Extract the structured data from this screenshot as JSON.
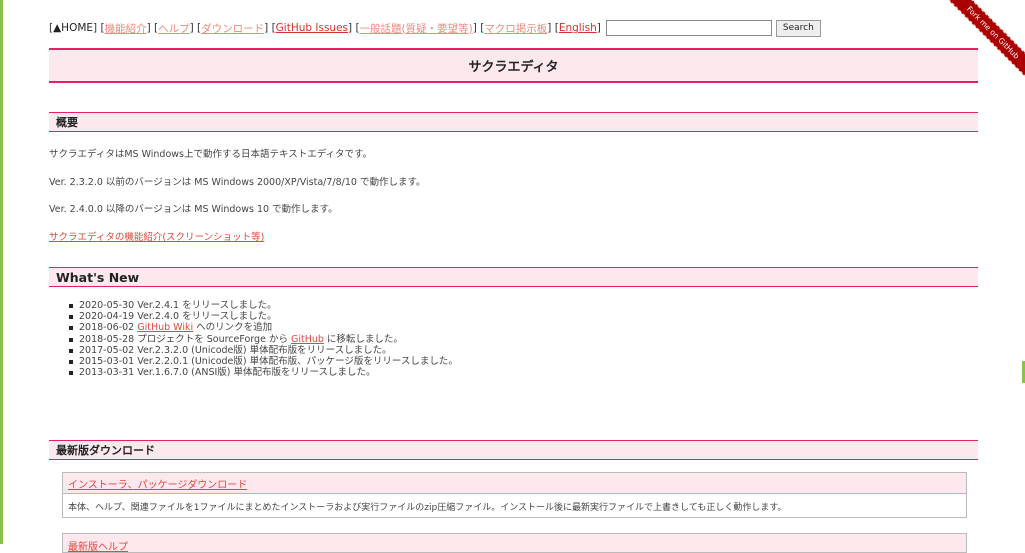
{
  "nav": {
    "home": "▲HOME",
    "features": "機能紹介",
    "help": "ヘルプ",
    "download": "ダウンロード",
    "issues": "GitHub Issues",
    "forum": "一般話題(質疑・要望等)",
    "macro": "マクロ掲示板",
    "english": "English",
    "search_value": "",
    "search_button": "Search"
  },
  "ribbon": "Fork me on GitHub",
  "page_title": "サクラエディタ",
  "overview": {
    "heading": "概要",
    "lines": [
      "サクラエディタはMS Windows上で動作する日本語テキストエディタです。",
      "Ver. 2.3.2.0 以前のバージョンは MS Windows 2000/XP/Vista/7/8/10 で動作します。",
      "Ver. 2.4.0.0 以降のバージョンは MS Windows 10 で動作します。"
    ],
    "link": "サクラエディタの機能紹介(スクリーンショット等)"
  },
  "whats_new": {
    "heading": "What's New",
    "items": [
      {
        "pre": "2020-05-30 Ver.2.4.1 をリリースしました。",
        "link": "",
        "post": ""
      },
      {
        "pre": "2020-04-19 Ver.2.4.0 をリリースしました。",
        "link": "",
        "post": ""
      },
      {
        "pre": "2018-06-02 ",
        "link": "GitHub Wiki",
        "post": " へのリンクを追加"
      },
      {
        "pre": "2018-05-28 プロジェクトを SourceForge から ",
        "link": "GitHub",
        "post": " に移転しました。"
      },
      {
        "pre": "2017-05-02 Ver.2.3.2.0 (Unicode版) 単体配布版をリリースしました。",
        "link": "",
        "post": ""
      },
      {
        "pre": "2015-03-01 Ver.2.2.0.1 (Unicode版) 単体配布版、パッケージ版をリリースしました。",
        "link": "",
        "post": ""
      },
      {
        "pre": "2013-03-31 Ver.1.6.7.0 (ANSI版) 単体配布版をリリースしました。",
        "link": "",
        "post": ""
      }
    ]
  },
  "downloads": {
    "heading": "最新版ダウンロード",
    "installer_link": "インストーラ、パッケージダウンロード",
    "installer_desc": "本体、ヘルプ、関連ファイルを1ファイルにまとめたインストーラおよび実行ファイルのzip圧縮ファイル。インストール後に最新実行ファイルで上書きしても正しく動作します。",
    "next_link": "最新版ヘルプ"
  }
}
